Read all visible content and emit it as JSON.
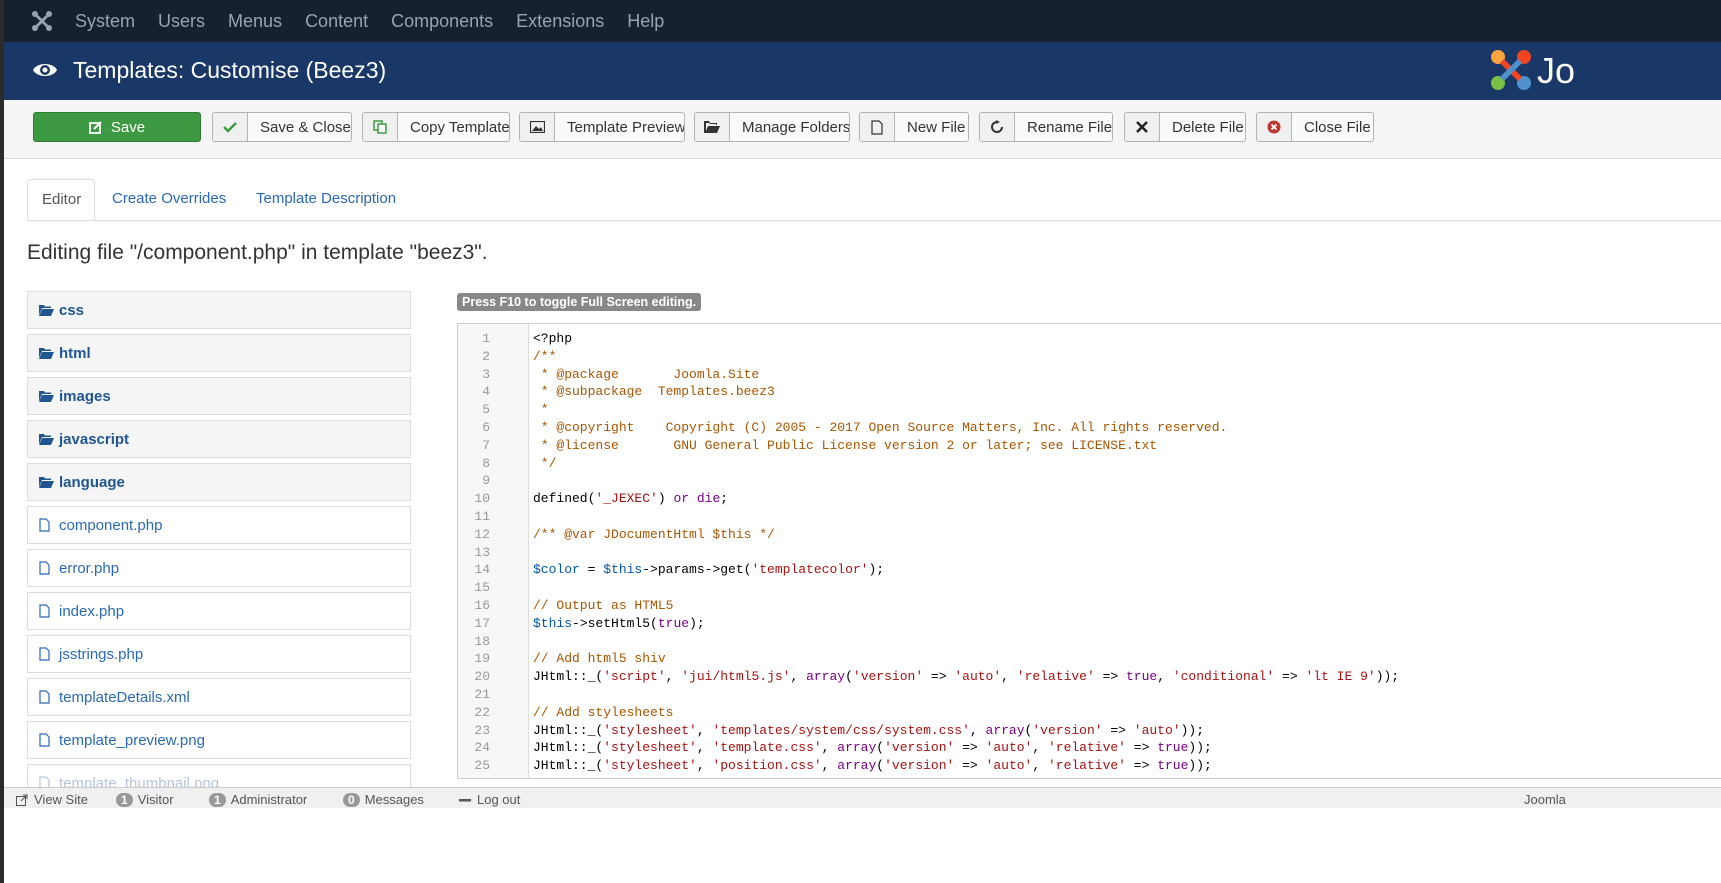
{
  "topnav": {
    "items": [
      "System",
      "Users",
      "Menus",
      "Content",
      "Components",
      "Extensions",
      "Help"
    ]
  },
  "header": {
    "title": "Templates: Customise (Beez3)",
    "brand_fragment": "Jo"
  },
  "toolbar": {
    "save": "Save",
    "save_close": "Save & Close",
    "copy_template": "Copy Template",
    "template_preview": "Template Preview",
    "manage_folders": "Manage Folders",
    "new_file": "New File",
    "rename_file": "Rename File",
    "delete_file": "Delete File",
    "close_file": "Close File"
  },
  "tabs": {
    "editor": "Editor",
    "overrides": "Create Overrides",
    "description": "Template Description"
  },
  "editing_heading": "Editing file \"/component.php\" in template \"beez3\".",
  "tree": {
    "folders": [
      "css",
      "html",
      "images",
      "javascript",
      "language"
    ],
    "files": [
      "component.php",
      "error.php",
      "index.php",
      "jsstrings.php",
      "templateDetails.xml",
      "template_preview.png",
      "template_thumbnail.png"
    ]
  },
  "editor": {
    "tip": "Press F10 to toggle Full Screen editing.",
    "line_numbers": [
      "1",
      "2",
      "3",
      "4",
      "5",
      "6",
      "7",
      "8",
      "9",
      "10",
      "11",
      "12",
      "13",
      "14",
      "15",
      "16",
      "17",
      "18",
      "19",
      "20",
      "21",
      "22",
      "23",
      "24",
      "25"
    ],
    "lines": [
      "<?php",
      "/**",
      " * @package       Joomla.Site",
      " * @subpackage  Templates.beez3",
      " *",
      " * @copyright    Copyright (C) 2005 - 2017 Open Source Matters, Inc. All rights reserved.",
      " * @license       GNU General Public License version 2 or later; see LICENSE.txt",
      " */",
      "",
      "defined('_JEXEC') or die;",
      "",
      "/** @var JDocumentHtml $this */",
      "",
      "$color = $this->params->get('templatecolor');",
      "",
      "// Output as HTML5",
      "$this->setHtml5(true);",
      "",
      "// Add html5 shiv",
      "JHtml::_('script', 'jui/html5.js', array('version' => 'auto', 'relative' => true, 'conditional' => 'lt IE 9'));",
      "",
      "// Add stylesheets",
      "JHtml::_('stylesheet', 'templates/system/css/system.css', array('version' => 'auto'));",
      "JHtml::_('stylesheet', 'template.css', array('version' => 'auto', 'relative' => true));",
      "JHtml::_('stylesheet', 'position.css', array('version' => 'auto', 'relative' => true));"
    ]
  },
  "status": {
    "view_site": "View Site",
    "visitor_count": "1",
    "visitor_label": "Visitor",
    "admin_count": "1",
    "admin_label": "Administrator",
    "messages_count": "0",
    "messages_label": "Messages",
    "logout": "Log out",
    "right_text": "Joomla"
  },
  "colors": {
    "topnav_bg": "#17202e",
    "header_bg": "#1a3867",
    "save_green": "#3e9a42",
    "link_blue": "#2a69b8"
  }
}
